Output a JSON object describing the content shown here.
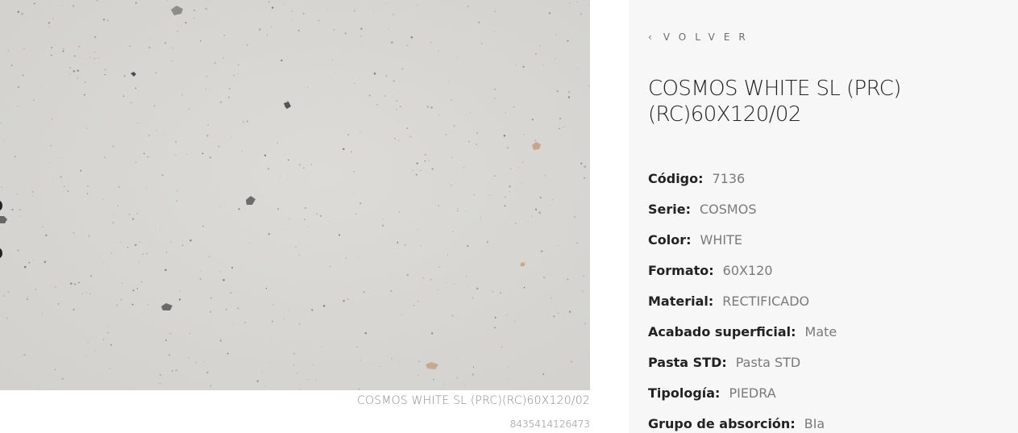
{
  "product": {
    "image_alt": "COSMOS WHITE SL (PRC)(RC)60X120/02",
    "caption_name": "COSMOS WHITE SL (PRC)(RC)60X120/02",
    "caption_ean": "8435414126473",
    "back_label": "VOLVER",
    "back_icon": "chevron-left-icon",
    "title": "COSMOS WHITE SL (PRC) (RC)60X120/02",
    "specs": [
      {
        "label": "Código:",
        "value": "7136"
      },
      {
        "label": "Serie:",
        "value": "COSMOS"
      },
      {
        "label": "Color:",
        "value": "WHITE"
      },
      {
        "label": "Formato:",
        "value": "60X120"
      },
      {
        "label": "Material:",
        "value": "RECTIFICADO"
      },
      {
        "label": "Acabado superficial:",
        "value": "Mate"
      },
      {
        "label": "Pasta STD:",
        "value": "Pasta STD"
      },
      {
        "label": "Tipología:",
        "value": "PIEDRA"
      },
      {
        "label": "Grupo de absorción:",
        "value": "BIa"
      }
    ]
  },
  "colors": {
    "tile_base": "#d7d6d2",
    "panel_bg": "#f7f7f7",
    "title_text": "#222222",
    "value_text": "#7a7a7a"
  }
}
